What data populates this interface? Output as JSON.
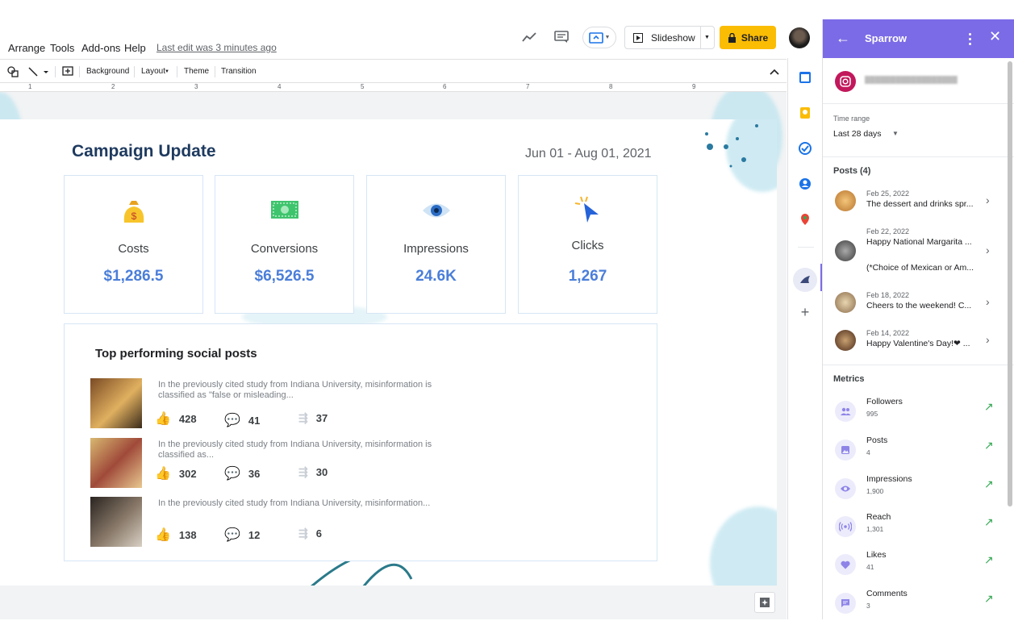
{
  "menu": {
    "items": [
      "Arrange",
      "Tools",
      "Add-ons",
      "Help"
    ],
    "last_edit": "Last edit was 3 minutes ago"
  },
  "top_actions": {
    "slideshow": "Slideshow",
    "share": "Share"
  },
  "toolbar": {
    "background": "Background",
    "layout": "Layout",
    "theme": "Theme",
    "transition": "Transition"
  },
  "ruler": [
    "1",
    "2",
    "3",
    "4",
    "5",
    "6",
    "7",
    "8",
    "9"
  ],
  "slide": {
    "title": "Campaign Update",
    "date_range": "Jun 01 - Aug 01, 2021",
    "kpis": [
      {
        "label": "Costs",
        "value": "$1,286.5",
        "icon": "money-bag-icon"
      },
      {
        "label": "Conversions",
        "value": "$6,526.5",
        "icon": "banknote-icon"
      },
      {
        "label": "Impressions",
        "value": "24.6K",
        "icon": "eye-icon"
      },
      {
        "label": "Clicks",
        "value": "1,267",
        "icon": "cursor-click-icon"
      }
    ],
    "posts_title": "Top performing social posts",
    "posts": [
      {
        "text": "In the previously cited study from Indiana University, misinformation is classified as \"false or misleading...",
        "likes": "428",
        "comments": "41",
        "shares": "37"
      },
      {
        "text": "In the previously cited study from Indiana University, misinformation is classified as...",
        "likes": "302",
        "comments": "36",
        "shares": "30"
      },
      {
        "text": "In the previously cited study from Indiana University, misinformation...",
        "likes": "138",
        "comments": "12",
        "shares": "6"
      }
    ]
  },
  "sidebar": {
    "title": "Sparrow",
    "account_name": "██████████████████",
    "time_range_label": "Time range",
    "time_range_value": "Last 28 days",
    "posts_heading": "Posts (4)",
    "posts": [
      {
        "date": "Feb 25, 2022",
        "text": "The dessert and drinks spr..."
      },
      {
        "date": "Feb 22, 2022",
        "text": "Happy National Margarita ...",
        "text2": "(*Choice of Mexican or Am..."
      },
      {
        "date": "Feb 18, 2022",
        "text": "Cheers to the weekend! C..."
      },
      {
        "date": "Feb 14, 2022",
        "text": "Happy Valentine's Day!❤ ..."
      }
    ],
    "metrics_heading": "Metrics",
    "metrics": [
      {
        "name": "Followers",
        "value": "995"
      },
      {
        "name": "Posts",
        "value": "4"
      },
      {
        "name": "Impressions",
        "value": "1,900"
      },
      {
        "name": "Reach",
        "value": "1,301"
      },
      {
        "name": "Likes",
        "value": "41"
      },
      {
        "name": "Comments",
        "value": "3"
      }
    ]
  },
  "colors": {
    "accent": "#7b6be6",
    "share": "#fbbc04",
    "kpi_value": "#4a7ed9",
    "title": "#1e3a5f"
  }
}
